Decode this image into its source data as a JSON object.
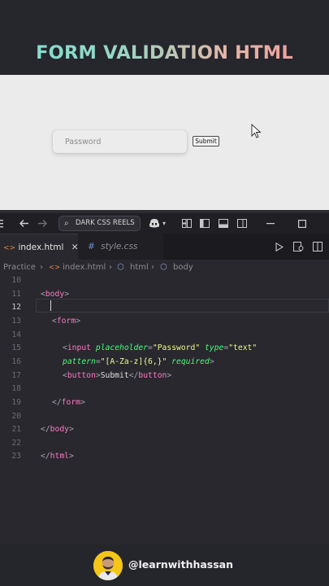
{
  "banner": {
    "title": "FORM VALIDATION HTML"
  },
  "preview": {
    "password_placeholder": "Password",
    "submit_label": "Submit"
  },
  "titlebar": {
    "command_center": "DARK CSS REELS"
  },
  "tabs": [
    {
      "label": "index.html",
      "active": true
    },
    {
      "label": "style.css",
      "active": false
    }
  ],
  "breadcrumb": {
    "folder": "Practice",
    "file": "index.html",
    "html": "html",
    "body": "body"
  },
  "code": {
    "line_numbers": [
      "10",
      "11",
      "12",
      "13",
      "14",
      "15",
      "16",
      "17",
      "18",
      "19",
      "20",
      "21",
      "22",
      "23"
    ],
    "current_line": "12",
    "lines": [
      {
        "tokens": []
      },
      {
        "tokens": [
          [
            "p",
            "<"
          ],
          [
            "tg",
            "body"
          ],
          [
            "p",
            ">"
          ]
        ]
      },
      {
        "tokens": []
      },
      {
        "tokens": [
          [
            "p",
            "<"
          ],
          [
            "tg",
            "form"
          ],
          [
            "p",
            ">"
          ]
        ]
      },
      {
        "tokens": []
      },
      {
        "tokens": [
          [
            "p",
            "<"
          ],
          [
            "tg",
            "input"
          ],
          [
            "tx",
            " "
          ],
          [
            "at",
            "placeholder"
          ],
          [
            "p",
            "="
          ],
          [
            "st",
            "\"Password\""
          ],
          [
            "tx",
            " "
          ],
          [
            "at",
            "type"
          ],
          [
            "p",
            "="
          ],
          [
            "st",
            "\"text\""
          ]
        ]
      },
      {
        "tokens": [
          [
            "at",
            "pattern"
          ],
          [
            "p",
            "="
          ],
          [
            "st",
            "\"[A-Za-z]{6,}\""
          ],
          [
            "tx",
            " "
          ],
          [
            "at",
            "required"
          ],
          [
            "p",
            ">"
          ]
        ]
      },
      {
        "tokens": [
          [
            "p",
            "<"
          ],
          [
            "tg",
            "button"
          ],
          [
            "p",
            ">"
          ],
          [
            "tx",
            "Submit"
          ],
          [
            "p",
            "</"
          ],
          [
            "tg",
            "button"
          ],
          [
            "p",
            ">"
          ]
        ]
      },
      {
        "tokens": []
      },
      {
        "tokens": [
          [
            "p",
            "</"
          ],
          [
            "tg",
            "form"
          ],
          [
            "p",
            ">"
          ]
        ]
      },
      {
        "tokens": []
      },
      {
        "tokens": [
          [
            "p",
            "</"
          ],
          [
            "tg",
            "body"
          ],
          [
            "p",
            ">"
          ]
        ]
      },
      {
        "tokens": []
      },
      {
        "tokens": [
          [
            "p",
            "</"
          ],
          [
            "tg",
            "html"
          ],
          [
            "p",
            ">"
          ]
        ]
      }
    ]
  },
  "footer": {
    "handle": "@learnwithhassan"
  },
  "colors": {
    "tag": "#ff79c6",
    "attribute": "#50fa7b",
    "string": "#f1fa8c",
    "editor_bg": "#28282e"
  }
}
